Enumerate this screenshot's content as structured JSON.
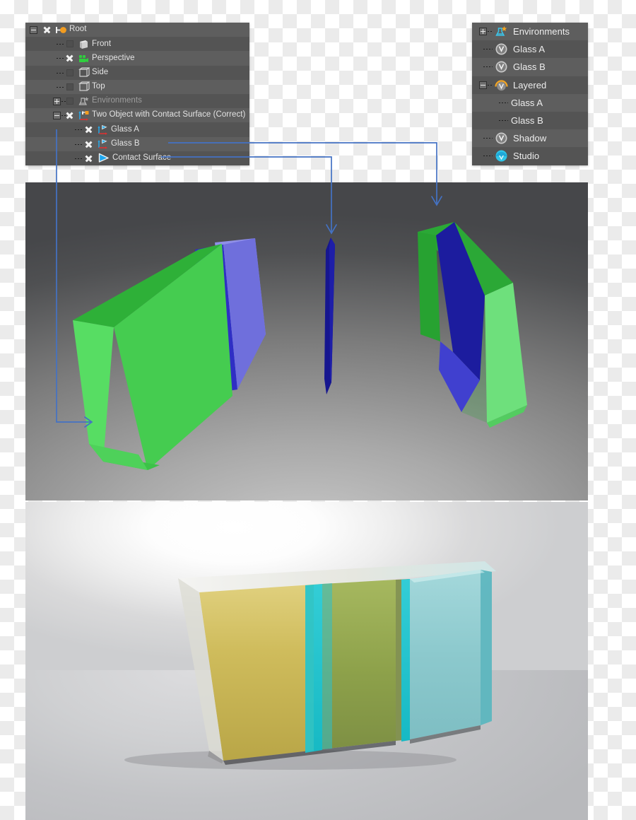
{
  "app": {
    "accent_blue": "#4472c4",
    "panel_bg": "#575757",
    "panel_row_alt": "#5e5e5e",
    "text_color": "#e3e3e3",
    "dim_text_color": "#9d9d9d"
  },
  "scene_tree": {
    "title": "Scene Tree",
    "rows": [
      {
        "label": "Root",
        "icon": "root-pivot-icon",
        "indent": 0,
        "visible": true,
        "expander": "minus",
        "dim": false
      },
      {
        "label": "Front",
        "icon": "camera-front-icon",
        "indent": 1,
        "visible": false,
        "expander": "none",
        "dim": false
      },
      {
        "label": "Perspective",
        "icon": "camera-perspective-icon",
        "indent": 1,
        "visible": true,
        "expander": "none",
        "dim": false
      },
      {
        "label": "Side",
        "icon": "camera-side-icon",
        "indent": 1,
        "visible": false,
        "expander": "none",
        "dim": false
      },
      {
        "label": "Top",
        "icon": "camera-top-icon",
        "indent": 1,
        "visible": false,
        "expander": "none",
        "dim": false
      },
      {
        "label": "Environments",
        "icon": "environments-icon",
        "indent": 1,
        "visible": false,
        "expander": "plus",
        "dim": true
      },
      {
        "label": "Two Object with Contact Surface (Correct)",
        "icon": "group-pivot-icon",
        "indent": 1,
        "visible": true,
        "expander": "minus",
        "dim": false
      },
      {
        "label": "Glass A",
        "icon": "axis-flag-icon",
        "indent": 2,
        "visible": true,
        "expander": "none",
        "dim": false
      },
      {
        "label": "Glass B",
        "icon": "axis-flag-icon",
        "indent": 2,
        "visible": true,
        "expander": "none",
        "dim": false
      },
      {
        "label": "Contact Surface",
        "icon": "surface-play-icon",
        "indent": 2,
        "visible": true,
        "expander": "none",
        "dim": false
      }
    ]
  },
  "environment_tree": {
    "title": "Environments",
    "rows": [
      {
        "label": "Environments",
        "icon": "environments-icon",
        "indent": 0,
        "expander": "plus",
        "big": true
      },
      {
        "label": "Glass A",
        "icon": "material-v-icon",
        "indent": 1,
        "expander": "none",
        "big": true
      },
      {
        "label": "Glass B",
        "icon": "material-v-icon",
        "indent": 1,
        "expander": "none",
        "big": true
      },
      {
        "label": "Layered",
        "icon": "layered-v-icon",
        "indent": 1,
        "expander": "minus",
        "big": true
      },
      {
        "label": "Glass A",
        "icon": "none",
        "indent": 2,
        "expander": "none",
        "big": true
      },
      {
        "label": "Glass B",
        "icon": "none",
        "indent": 2,
        "expander": "none",
        "big": true
      },
      {
        "label": "Shadow",
        "icon": "material-v-icon",
        "indent": 1,
        "expander": "none",
        "big": true
      },
      {
        "label": "Studio",
        "icon": "studio-v-icon",
        "indent": 1,
        "expander": "none",
        "big": true
      }
    ]
  },
  "viewport_top": {
    "name": "shaded-preview-viewport",
    "objects": [
      {
        "name": "glass-a-slab",
        "colors": {
          "front": "#3fcc4b",
          "top": "#27a82f",
          "side": "#55d861"
        }
      },
      {
        "name": "contact-surface-sliver",
        "colors": {
          "front": "#1a1a9c",
          "edge": "#12127a"
        }
      },
      {
        "name": "glass-b-slab",
        "colors": {
          "front": "#6be57b",
          "top": "#2aa835",
          "blue": "#2424a8"
        }
      }
    ]
  },
  "viewport_bottom": {
    "name": "rendered-glass-viewport",
    "objects": [
      {
        "name": "amber-glass-panel",
        "color": "#c8b550"
      },
      {
        "name": "olive-glass-panel",
        "color": "#8d9e4a"
      },
      {
        "name": "cyan-glass-panel",
        "color": "#7fc3c6"
      },
      {
        "name": "teal-edge",
        "color": "#1fc4cf"
      }
    ]
  },
  "callouts": [
    {
      "name": "callout-glass-a",
      "from": "Glass A",
      "to": "left object"
    },
    {
      "name": "callout-glass-b",
      "from": "Glass B",
      "to": "right object"
    },
    {
      "name": "callout-contact-surface",
      "from": "Contact Surface",
      "to": "middle sliver"
    }
  ]
}
